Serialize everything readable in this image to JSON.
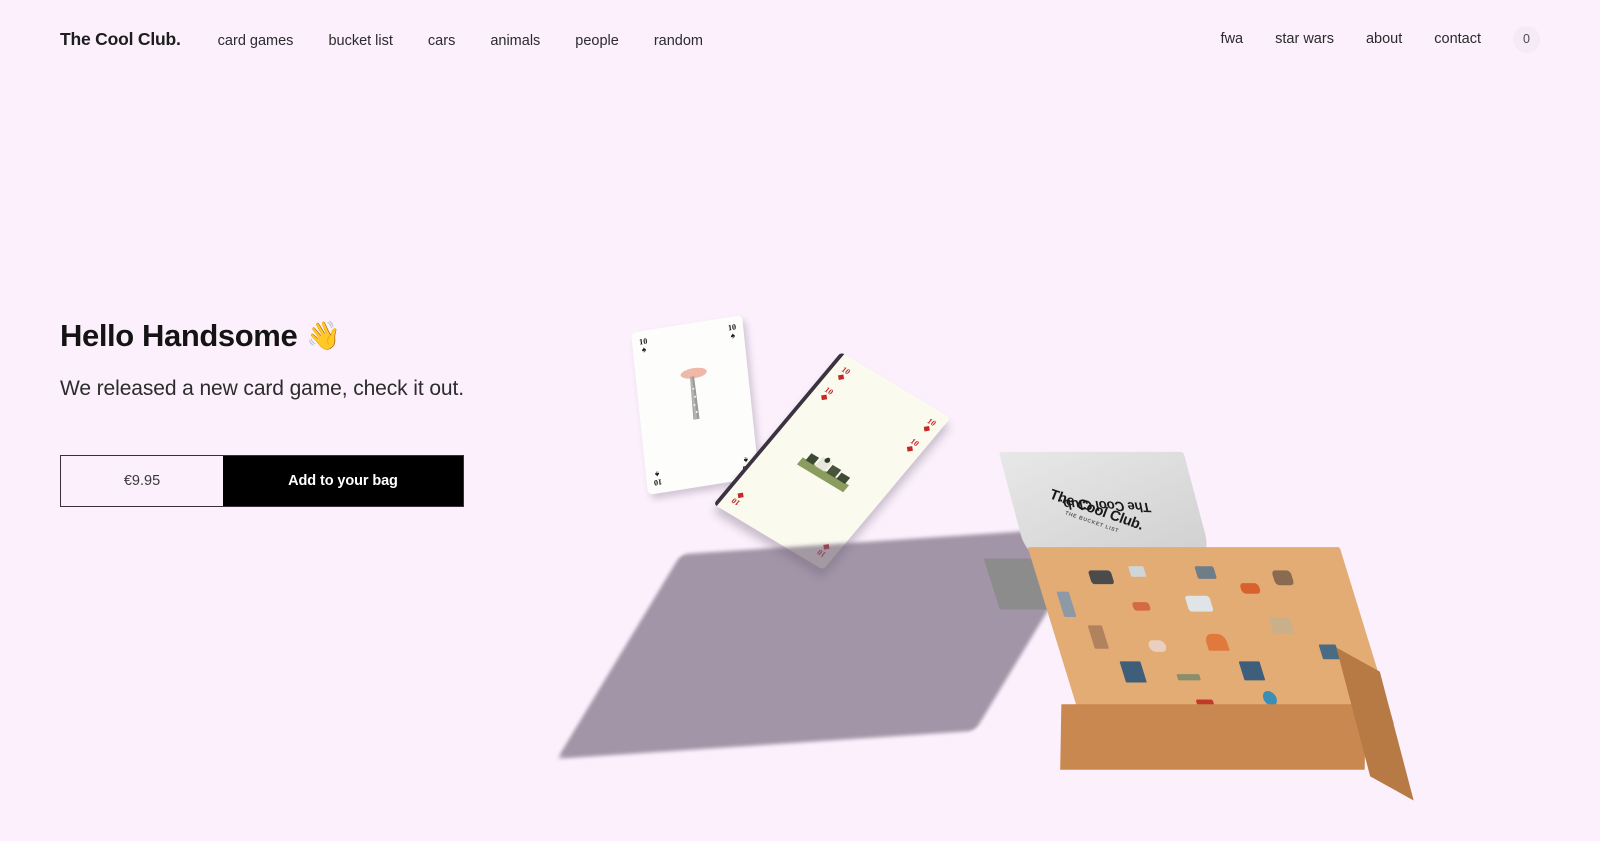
{
  "site": {
    "background_color": "#fbf0fc",
    "logo": "The Cool Club."
  },
  "nav": {
    "left_links": [
      {
        "label": "card games",
        "name": "nav-link-card-games"
      },
      {
        "label": "bucket list",
        "name": "nav-link-bucket-list"
      },
      {
        "label": "cars",
        "name": "nav-link-cars"
      },
      {
        "label": "animals",
        "name": "nav-link-animals"
      },
      {
        "label": "people",
        "name": "nav-link-people"
      },
      {
        "label": "random",
        "name": "nav-link-random"
      }
    ],
    "right_links": [
      {
        "label": "fwa",
        "name": "nav-link-fwa"
      },
      {
        "label": "star wars",
        "name": "nav-link-star-wars"
      },
      {
        "label": "about",
        "name": "nav-link-about"
      },
      {
        "label": "contact",
        "name": "nav-link-contact"
      }
    ],
    "cart_count": "0"
  },
  "hero": {
    "title": "Hello Handsome",
    "wave_emoji": "👋",
    "subtitle": "We released a new card game, check it out.",
    "price": "€9.95",
    "add_to_bag_label": "Add to your bag"
  },
  "product": {
    "box_brand": "The Cool Club.",
    "box_subtitle": "THE BUCKET LIST",
    "lid_brand": "The Cool Club.",
    "cards": [
      {
        "rank": "10",
        "suit_symbol": "♠",
        "suit": "spades",
        "color": "#151515"
      },
      {
        "rank": "10",
        "suit_symbol": "◆",
        "suit": "diamonds",
        "color": "#c62828"
      }
    ]
  }
}
